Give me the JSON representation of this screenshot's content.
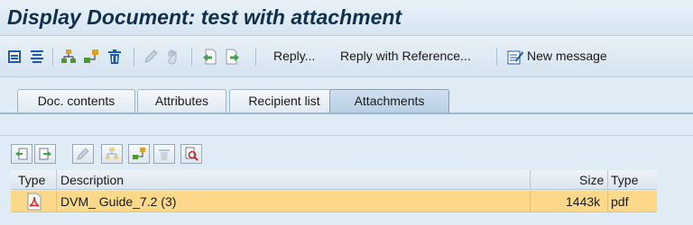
{
  "window": {
    "title": "Display Document: test with attachment"
  },
  "toolbar": {
    "icons": [
      "print-icon",
      "text-format-icon",
      "tree-icon",
      "structure-icon",
      "delete-icon",
      "edit-icon",
      "hold-icon",
      "previous-page-icon",
      "next-page-icon"
    ],
    "reply_label": "Reply...",
    "reply_ref_label": "Reply with Reference...",
    "new_message_label": "New message"
  },
  "tabs": [
    {
      "label": "Doc. contents",
      "active": false
    },
    {
      "label": "Attributes",
      "active": false
    },
    {
      "label": "Recipient list",
      "active": false
    },
    {
      "label": "Attachments",
      "active": true
    }
  ],
  "attachment_toolbar": {
    "icons": [
      "import-icon",
      "export-icon",
      "edit-icon",
      "tree-icon",
      "structure-icon",
      "delete-icon",
      "find-icon"
    ]
  },
  "table": {
    "columns": {
      "type": "Type",
      "description": "Description",
      "size": "Size",
      "type2": "Type"
    },
    "rows": [
      {
        "type_icon": "pdf-icon",
        "description": "DVM_ Guide_7.2 (3)",
        "size": "1443k",
        "filetype": "pdf"
      }
    ]
  },
  "colors": {
    "selected_row": "#fbd88a",
    "title_text": "#0f2f4f",
    "background": "#dfebf5"
  }
}
